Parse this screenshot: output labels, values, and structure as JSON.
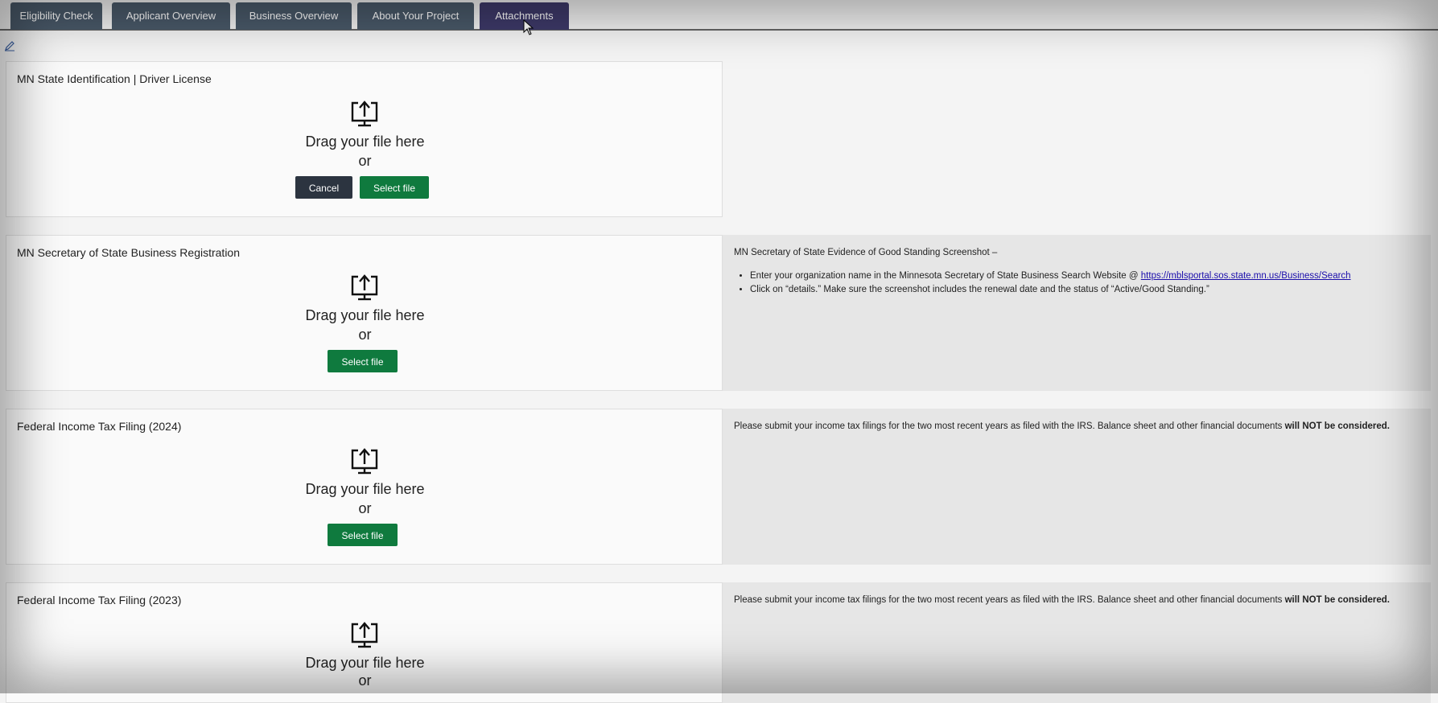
{
  "tabs": [
    {
      "label": "Eligibility Check"
    },
    {
      "label": "Applicant Overview"
    },
    {
      "label": "Business Overview"
    },
    {
      "label": "About Your Project"
    },
    {
      "label": "Attachments"
    }
  ],
  "upload": {
    "drag_text": "Drag your file here",
    "or_text": "or",
    "select_label": "Select file",
    "cancel_label": "Cancel"
  },
  "sections": [
    {
      "title": "MN State Identification | Driver License"
    },
    {
      "title": "MN Secretary of State Business Registration"
    },
    {
      "title": "Federal Income Tax Filing (2024)"
    },
    {
      "title": "Federal Income Tax Filing (2023)"
    }
  ],
  "info": {
    "sos": {
      "heading": "MN Secretary of State Evidence of Good Standing Screenshot –",
      "bullet1_text": "Enter your organization name in the Minnesota Secretary of State Business Search Website @ ",
      "bullet1_link": "https://mblsportal.sos.state.mn.us/Business/Search",
      "bullet2_text": "Click on “details.” Make sure the screenshot includes the renewal date and the status of “Active/Good Standing.”"
    },
    "tax": {
      "text": "Please submit your income tax filings for the two most recent years as filed with the IRS. Balance sheet and other financial documents ",
      "bold": "will NOT be considered."
    }
  },
  "colors": {
    "tab_bg": "#4a5a6a",
    "tab_active_bg": "#3e3a6a",
    "select_button": "#0f7a3e",
    "cancel_button": "#2c3440"
  }
}
